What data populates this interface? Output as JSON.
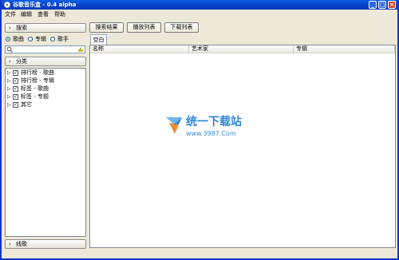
{
  "window": {
    "title": "谷歌音乐盒 - 0.4 alpha"
  },
  "titlebar_buttons": {
    "minimize": "_",
    "maximize": "□",
    "close": "×"
  },
  "menu": [
    "文件",
    "编辑",
    "查看",
    "帮助"
  ],
  "sidebar": {
    "search_expander": "搜索",
    "radios": [
      {
        "label": "歌曲",
        "selected": true
      },
      {
        "label": "专辑",
        "selected": false
      },
      {
        "label": "歌手",
        "selected": false
      }
    ],
    "search_value": "",
    "category_expander": "分类",
    "tree": [
      "排行榜 - 歌曲",
      "排行榜 - 专辑",
      "标签 - 歌曲",
      "标签 - 专题",
      "其它"
    ],
    "playlist_expander": "线歌"
  },
  "toolbar": {
    "results": "搜索结果",
    "play_list": "播放列表",
    "download_list": "下载列表"
  },
  "tab": {
    "label": "空白"
  },
  "table": {
    "columns": [
      "名称",
      "艺术家",
      "专辑"
    ]
  },
  "watermark": {
    "title": "统一下载站",
    "url": "www.3987.Com"
  },
  "colors": {
    "titlebar": "#0840c7",
    "window_bg": "#ece9d8",
    "accent": "#2f86d6"
  }
}
